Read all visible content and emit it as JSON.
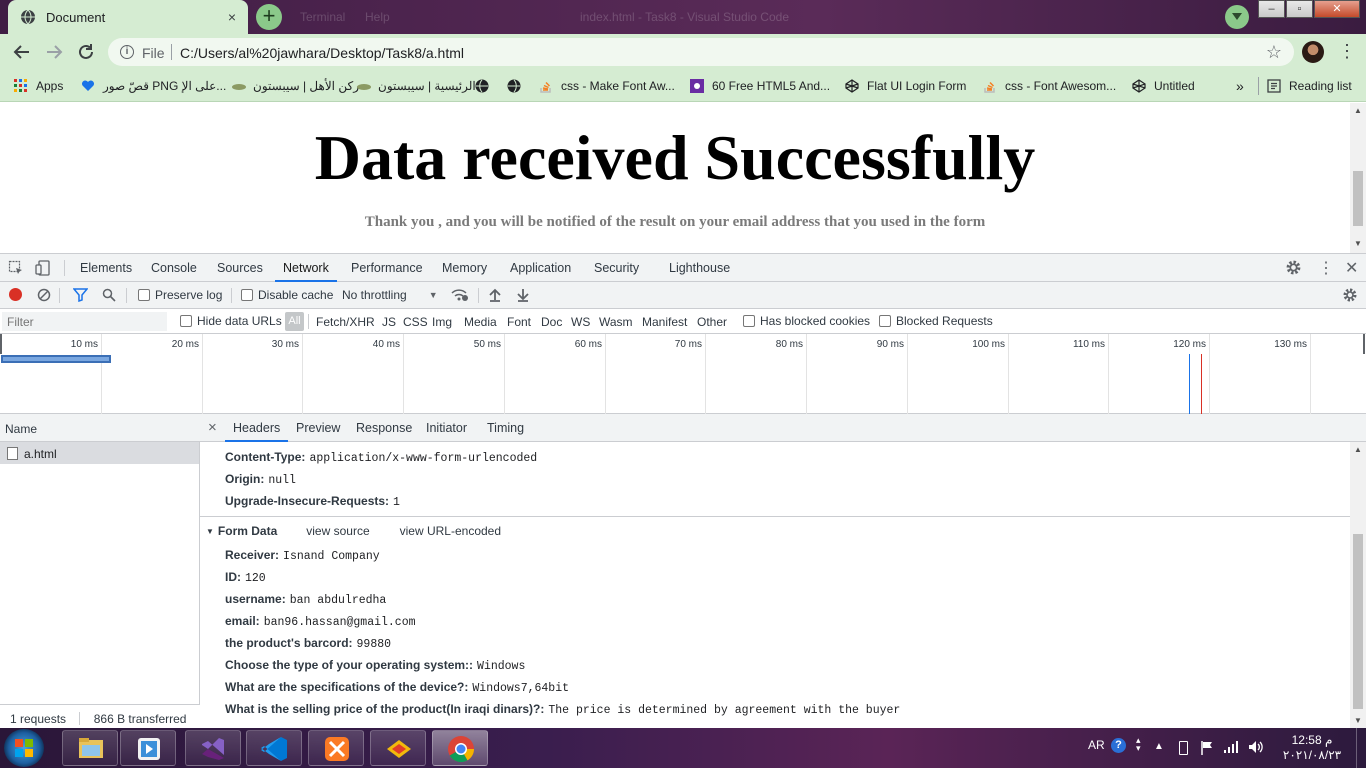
{
  "browser": {
    "tab_title": "Document",
    "tab_close": "×",
    "new_tab": "+",
    "faint_window_texts": [
      "Terminal",
      "Help",
      "index.html - Task8 - Visual Studio Code"
    ],
    "omnibox": {
      "scheme": "File",
      "url": "C:/Users/al%20jawhara/Desktop/Task8/a.html"
    },
    "window_buttons": {
      "minimize": "–",
      "maximize": "▫",
      "close": "✕"
    },
    "bookmarks": [
      {
        "label": "Apps",
        "icon": "apps-grid-icon"
      },
      {
        "label": "قصّ صور PNG على الإ...",
        "icon": "heart-icon"
      },
      {
        "label": "ركن الأهل | سيبستون",
        "icon": "site-icon"
      },
      {
        "label": "الرئيسية | سيبستون",
        "icon": "site-icon"
      },
      {
        "label": "",
        "icon": "globe-icon"
      },
      {
        "label": "",
        "icon": "globe-icon"
      },
      {
        "label": "css - Make Font Aw...",
        "icon": "stackoverflow-icon"
      },
      {
        "label": "60 Free HTML5 And...",
        "icon": "colorlib-icon"
      },
      {
        "label": "Flat UI Login Form",
        "icon": "codepen-icon"
      },
      {
        "label": "css - Font Awesom...",
        "icon": "stackoverflow-icon"
      },
      {
        "label": "Untitled",
        "icon": "codepen-icon"
      }
    ],
    "bookmarks_more": "»",
    "reading_list": "Reading list"
  },
  "page": {
    "heading": "Data received Successfully",
    "message": "Thank you , and you will be notified of the result on your email address that you used in the form"
  },
  "devtools": {
    "tabs": [
      "Elements",
      "Console",
      "Sources",
      "Network",
      "Performance",
      "Memory",
      "Application",
      "Security",
      "Lighthouse"
    ],
    "active_tab": "Network",
    "controls": {
      "preserve_log": "Preserve log",
      "disable_cache": "Disable cache",
      "throttling": "No throttling"
    },
    "filter": {
      "placeholder": "Filter",
      "hide_data_urls": "Hide data URLs",
      "all": "All",
      "types": [
        "Fetch/XHR",
        "JS",
        "CSS",
        "Img",
        "Media",
        "Font",
        "Doc",
        "WS",
        "Wasm",
        "Manifest",
        "Other"
      ],
      "has_blocked_cookies": "Has blocked cookies",
      "blocked_requests": "Blocked Requests"
    },
    "timeline_ticks": [
      "10 ms",
      "20 ms",
      "30 ms",
      "40 ms",
      "50 ms",
      "60 ms",
      "70 ms",
      "80 ms",
      "90 ms",
      "100 ms",
      "110 ms",
      "120 ms",
      "130 ms"
    ],
    "requests": {
      "name_header": "Name",
      "items": [
        "a.html"
      ],
      "status": {
        "count": "1 requests",
        "transferred": "866 B transferred"
      }
    },
    "detail": {
      "close": "×",
      "tabs": [
        "Headers",
        "Preview",
        "Response",
        "Initiator",
        "Timing"
      ],
      "active_tab": "Headers",
      "request_headers": [
        {
          "key": "Content-Type:",
          "value": "application/x-www-form-urlencoded"
        },
        {
          "key": "Origin:",
          "value": "null"
        },
        {
          "key": "Upgrade-Insecure-Requests:",
          "value": "1"
        }
      ],
      "form_data": {
        "title": "Form Data",
        "view_source": "view source",
        "view_url_encoded": "view URL-encoded",
        "rows": [
          {
            "key": "Receiver:",
            "value": "Isnand Company"
          },
          {
            "key": "ID:",
            "value": "120"
          },
          {
            "key": "username:",
            "value": "ban abdulredha"
          },
          {
            "key": "email:",
            "value": "ban96.hassan@gmail.com"
          },
          {
            "key": "the product's barcord:",
            "value": "99880"
          },
          {
            "key": "Choose the type of your operating system::",
            "value": "Windows"
          },
          {
            "key": "What are the specifications of the device?:",
            "value": "Windows7,64bit"
          },
          {
            "key": "What is the selling price of the product(In iraqi dinars)?:",
            "value": "The price is determined by agreement with the buyer"
          }
        ]
      }
    }
  },
  "taskbar": {
    "apps": [
      "windows-explorer-icon",
      "media-player-icon",
      "visual-studio-icon",
      "vscode-icon",
      "xampp-icon",
      "app-icon",
      "chrome-icon"
    ],
    "language": "AR",
    "time": "12:58 م",
    "date": "٢٠٢١/٠٨/٢٣"
  },
  "colors": {
    "chrome_theme": "#d5ecd2",
    "title_bar": "#3f1d44",
    "devtools_accent": "#1a73e8",
    "record": "#d93025"
  }
}
